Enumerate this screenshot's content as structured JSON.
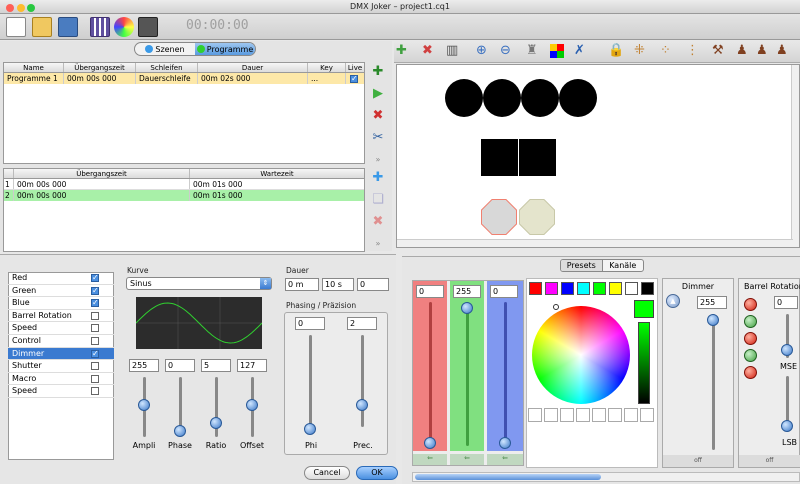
{
  "window": {
    "title": "DMX Joker – project1.cq1"
  },
  "toolbar": {
    "timer": "00:00:00"
  },
  "mode_tabs": {
    "scenes": "Szenen",
    "programs": "Programme"
  },
  "programs_table": {
    "columns": [
      "Name",
      "Übergangszeit",
      "Schleifen",
      "Dauer",
      "Key",
      "Live"
    ],
    "rows": [
      {
        "name": "Programme 1",
        "transition": "00m 00s 000",
        "loops": "Dauerschleife",
        "duration": "00m 02s 000",
        "key": "..."
      }
    ]
  },
  "steps_table": {
    "columns": [
      "Übergangszeit",
      "Wartezeit"
    ],
    "rows": [
      {
        "index": "1",
        "transition": "00m 00s 000",
        "wait": "00m 01s 000"
      },
      {
        "index": "2",
        "transition": "00m 00s 000",
        "wait": "00m 01s 000"
      }
    ]
  },
  "channels": [
    {
      "name": "Red",
      "checked": true
    },
    {
      "name": "Green",
      "checked": true
    },
    {
      "name": "Blue",
      "checked": true
    },
    {
      "name": "Barrel Rotation",
      "checked": false
    },
    {
      "name": "Speed",
      "checked": false
    },
    {
      "name": "Control",
      "checked": false
    },
    {
      "name": "Dimmer",
      "checked": true
    },
    {
      "name": "Shutter",
      "checked": false
    },
    {
      "name": "Macro",
      "checked": false
    },
    {
      "name": "Speed",
      "checked": false
    }
  ],
  "curve": {
    "title": "Kurve",
    "selected": "Sinus",
    "params": [
      {
        "label": "Ampli",
        "value": "255"
      },
      {
        "label": "Phase",
        "value": "0"
      },
      {
        "label": "Ratio",
        "value": "5"
      },
      {
        "label": "Offset",
        "value": "127"
      }
    ]
  },
  "duration": {
    "title": "Dauer",
    "minutes": "0 m",
    "seconds": "10 s",
    "millis": "0"
  },
  "phasing": {
    "title": "Phasing / Präzision",
    "params": [
      {
        "label": "Phi",
        "value": "0"
      },
      {
        "label": "Prec.",
        "value": "2"
      }
    ]
  },
  "dialog": {
    "cancel": "Cancel",
    "ok": "OK"
  },
  "right_tabs": {
    "presets": "Presets",
    "channels": "Kanäle"
  },
  "rgb": {
    "r": "0",
    "g": "255",
    "b": "0"
  },
  "swatch_colors": [
    "#ff0000",
    "#ff00ff",
    "#0000ff",
    "#00ffff",
    "#00ff00",
    "#ffff00",
    "#ffffff",
    "#000000"
  ],
  "dimmer_panel": {
    "title": "Dimmer",
    "value": "255",
    "footer": "off"
  },
  "barrel_panel": {
    "title": "Barrel Rotation",
    "value": "0",
    "msb": "MSE",
    "lsb": "LSB",
    "footer": "off"
  },
  "colors": {
    "accent": "#4a90e0",
    "selected_row": "#fde8a8",
    "green_row": "#a8f0a8",
    "red": "#f06060",
    "green": "#60e060",
    "blue": "#6090f0"
  }
}
